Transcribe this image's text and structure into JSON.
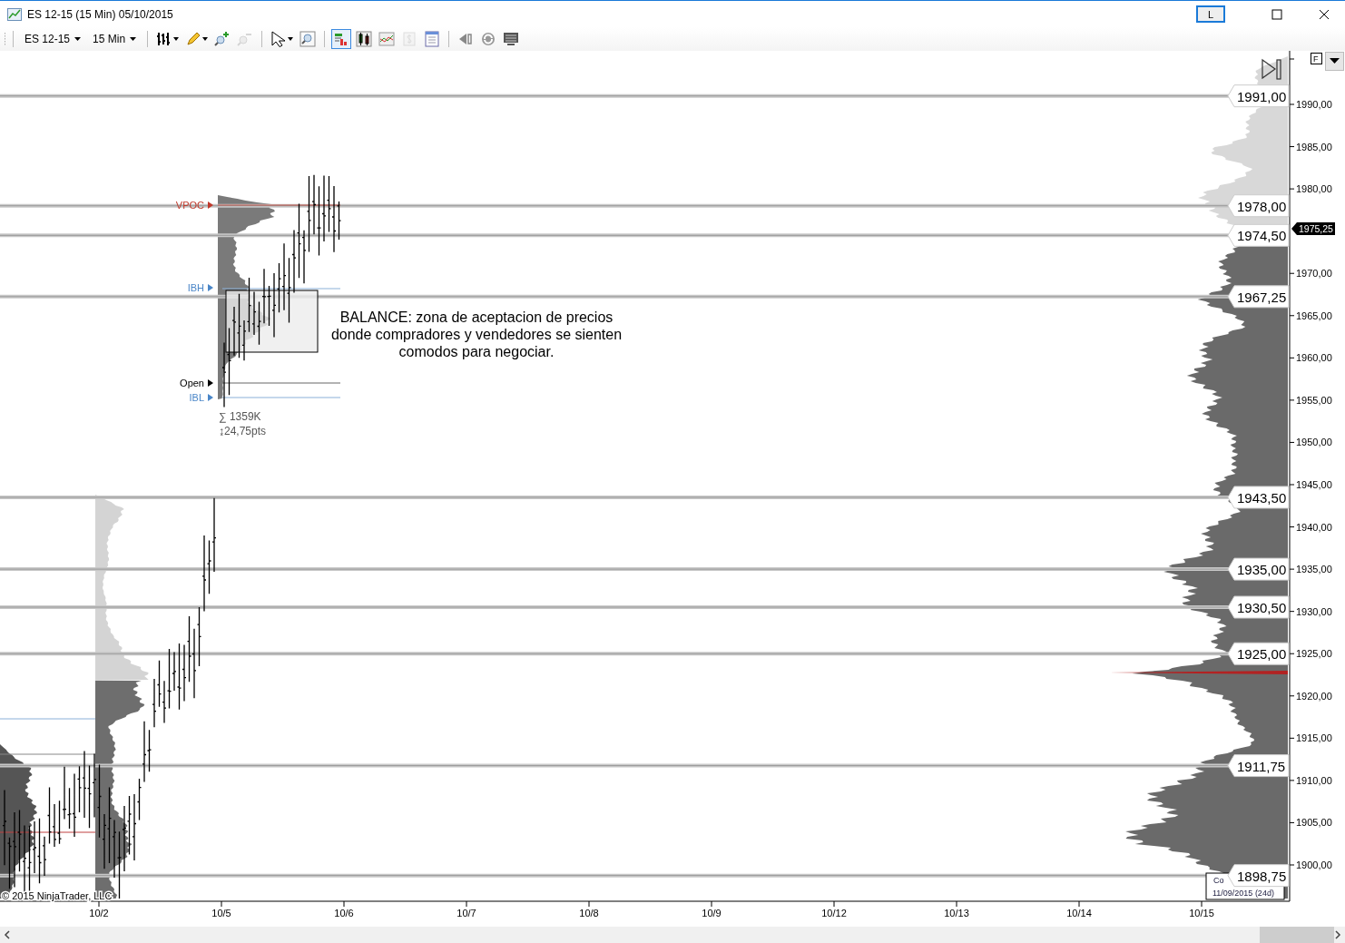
{
  "window": {
    "title": "ES 12-15 (15 Min)  05/10/2015",
    "layout_button": {
      "label": "L",
      "selected": true
    }
  },
  "toolbar": {
    "instrument": "ES 12-15",
    "interval": "15 Min",
    "tool_groups": [
      [
        {
          "kind": "bar-style",
          "dropdown": true,
          "selected": false,
          "disabled": false
        },
        {
          "kind": "pencil",
          "dropdown": true,
          "selected": false,
          "disabled": false
        },
        {
          "kind": "zoom-in",
          "dropdown": false,
          "selected": false,
          "disabled": false
        },
        {
          "kind": "zoom-out",
          "dropdown": false,
          "selected": false,
          "disabled": true
        }
      ],
      [
        {
          "kind": "cursor",
          "dropdown": true,
          "selected": false,
          "disabled": false
        },
        {
          "kind": "zoom-box",
          "dropdown": false,
          "selected": false,
          "disabled": false
        }
      ],
      [
        {
          "kind": "data-box",
          "dropdown": false,
          "selected": true,
          "disabled": false
        },
        {
          "kind": "candles",
          "dropdown": false,
          "selected": false,
          "disabled": false
        },
        {
          "kind": "line-chart",
          "dropdown": false,
          "selected": false,
          "disabled": false
        },
        {
          "kind": "dollar",
          "dropdown": false,
          "selected": false,
          "disabled": true
        },
        {
          "kind": "panel",
          "dropdown": false,
          "selected": false,
          "disabled": false
        }
      ],
      [
        {
          "kind": "rewind",
          "dropdown": false,
          "selected": false,
          "disabled": false
        },
        {
          "kind": "refresh",
          "dropdown": false,
          "selected": false,
          "disabled": false
        },
        {
          "kind": "monitor",
          "dropdown": false,
          "selected": false,
          "disabled": false
        }
      ]
    ]
  },
  "chart": {
    "y_ticks": [
      "1990,00",
      "1985,00",
      "1980,00",
      "1970,00",
      "1965,00",
      "1960,00",
      "1955,00",
      "1950,00",
      "1945,00",
      "1940,00",
      "1935,00",
      "1930,00",
      "1925,00",
      "1920,00",
      "1915,00",
      "1910,00",
      "1905,00",
      "1900,00"
    ],
    "x_ticks": [
      "10/2",
      "10/5",
      "10/6",
      "10/7",
      "10/8",
      "10/9",
      "10/12",
      "10/13",
      "10/14",
      "10/15"
    ],
    "levels": [
      {
        "label": "1991,00"
      },
      {
        "label": "1978,00"
      },
      {
        "label": "1974,50"
      },
      {
        "label": "1967,25"
      },
      {
        "label": "1943,50"
      },
      {
        "label": "1935,00"
      },
      {
        "label": "1930,50"
      },
      {
        "label": "1925,00"
      },
      {
        "label": "1911,75"
      },
      {
        "label": "1898,75"
      }
    ],
    "current_price": "1975,25",
    "markers": [
      {
        "label": "VPOC",
        "color": "#c0392b"
      },
      {
        "label": "IBH",
        "color": "#4a86c8"
      },
      {
        "label": "Open",
        "color": "#000000"
      },
      {
        "label": "IBL",
        "color": "#4a86c8"
      }
    ],
    "stats": [
      "∑ 1359K",
      "↨24,75pts"
    ],
    "note": "BALANCE: zona de aceptacion de precios donde compradores y vendedores se sienten comodos para negociar.",
    "copyright": "© 2015 NinjaTrader, LLC",
    "info_box": [
      "Co",
      "11/09/2015 (24d)"
    ],
    "f_button": "F"
  }
}
